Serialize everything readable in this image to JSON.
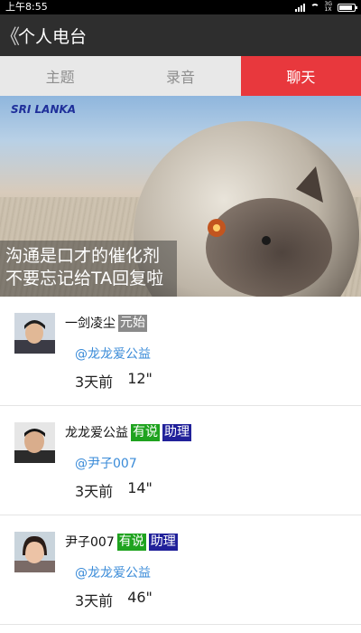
{
  "status_bar": {
    "time": "上午8:55",
    "network_label": "3G\n1X"
  },
  "header": {
    "back_glyph": "《",
    "title": "个人电台"
  },
  "tabs": [
    {
      "label": "主题",
      "active": false
    },
    {
      "label": "录音",
      "active": false
    },
    {
      "label": "聊天",
      "active": true
    }
  ],
  "banner": {
    "brand": "SRI LANKA",
    "line1": "沟通是口才的催化剂",
    "line2": "不要忘记给TA回复啦"
  },
  "posts": [
    {
      "username": "一剑凌尘",
      "badges": [
        {
          "text": "元始",
          "color": "#8a8a8a"
        }
      ],
      "mention": "@龙龙爱公益",
      "time": "3天前",
      "duration": "12\""
    },
    {
      "username": "龙龙爱公益",
      "badges": [
        {
          "text": "有说",
          "color": "#1fa31f"
        },
        {
          "text": "助理",
          "color": "#21219a"
        }
      ],
      "mention": "@尹子007",
      "time": "3天前",
      "duration": "14\""
    },
    {
      "username": "尹子007",
      "badges": [
        {
          "text": "有说",
          "color": "#1fa31f"
        },
        {
          "text": "助理",
          "color": "#21219a"
        }
      ],
      "mention": "@龙龙爱公益",
      "time": "3天前",
      "duration": "46\""
    }
  ],
  "colors": {
    "accent": "#e8383d",
    "title_bar": "#2e2e2e",
    "mention": "#3a8bd8"
  }
}
